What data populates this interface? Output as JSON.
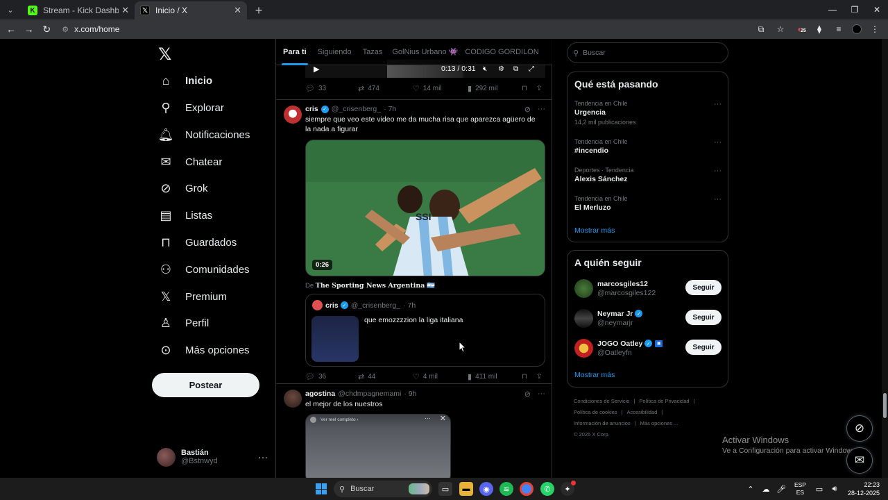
{
  "browser": {
    "tabs": [
      {
        "title": "Stream - Kick Dashboard",
        "favicon": "kick-icon",
        "active": false
      },
      {
        "title": "Inicio / X",
        "favicon": "x-icon",
        "active": true
      }
    ],
    "url": "x.com/home",
    "extension_badge": "25"
  },
  "sidebar": {
    "items": [
      {
        "label": "Inicio",
        "icon": "home-icon"
      },
      {
        "label": "Explorar",
        "icon": "search-icon"
      },
      {
        "label": "Notificaciones",
        "icon": "bell-icon"
      },
      {
        "label": "Chatear",
        "icon": "mail-icon"
      },
      {
        "label": "Grok",
        "icon": "grok-icon"
      },
      {
        "label": "Listas",
        "icon": "list-icon"
      },
      {
        "label": "Guardados",
        "icon": "bookmark-icon"
      },
      {
        "label": "Comunidades",
        "icon": "people-icon"
      },
      {
        "label": "Premium",
        "icon": "x-logo-icon"
      },
      {
        "label": "Perfil",
        "icon": "person-icon"
      },
      {
        "label": "Más opciones",
        "icon": "more-circle-icon"
      }
    ],
    "post_button": "Postear",
    "account": {
      "name": "Bastián",
      "handle": "@Bstnwyd"
    }
  },
  "feed": {
    "tabs": [
      "Para ti",
      "Siguiendo",
      "Tazas",
      "GolNius Urbano 👾",
      "CODIGO GORDILON"
    ],
    "prev_post": {
      "video_time": "0:13 / 0:31",
      "replies": "33",
      "reposts": "474",
      "likes": "14 mil",
      "views": "292 mil"
    },
    "post1": {
      "name": "cris",
      "handle": "@_crisenberg_",
      "time": "· 7h",
      "text": "siempre que veo este video me da mucha risa que aparezca agüero de la nada a figurar",
      "duration": "0:26",
      "source_prefix": "De",
      "source_name": "The Sporting News Argentina",
      "source_flag": "🇦🇷",
      "quote": {
        "name": "cris",
        "handle": "@_crisenberg_",
        "time": "· 7h",
        "text": "que emozzzzion la liga italiana"
      },
      "replies": "36",
      "reposts": "44",
      "likes": "4 mil",
      "views": "411 mil"
    },
    "post2": {
      "name": "agostina",
      "handle": "@chdmpagnemami",
      "time": "· 9h",
      "text": "el mejor de los nuestros",
      "embed_label": "Ver reel completo ›"
    }
  },
  "right": {
    "search_placeholder": "Buscar",
    "trends_title": "Qué está pasando",
    "trends": [
      {
        "category": "Tendencia en Chile",
        "name": "Urgencia",
        "count": "14,2 mil publicaciones"
      },
      {
        "category": "Tendencia en Chile",
        "name": "#incendio",
        "count": ""
      },
      {
        "category": "Deportes · Tendencia",
        "name": "Alexis Sánchez",
        "count": ""
      },
      {
        "category": "Tendencia en Chile",
        "name": "El Merluzo",
        "count": ""
      }
    ],
    "show_more": "Mostrar más",
    "follow_title": "A quién seguir",
    "follow": [
      {
        "name": "marcosgiles12",
        "handle": "@marcosgiles122",
        "button": "Seguir"
      },
      {
        "name": "Neymar Jr",
        "handle": "@neymarjr",
        "button": "Seguir"
      },
      {
        "name": "JOGO Oatley",
        "handle": "@Oatleyfn",
        "button": "Seguir"
      }
    ],
    "footer": [
      "Condiciones de Servicio",
      "|",
      "Política de Privacidad",
      "|",
      "Política de cookies",
      "|",
      "Accesibilidad",
      "|",
      "Información de anuncios",
      "|",
      "Más opciones ...",
      "© 2025 X Corp."
    ]
  },
  "watermark": {
    "line1": "Activar Windows",
    "line2": "Ve a Configuración para activar Windows."
  },
  "taskbar": {
    "search_placeholder": "Buscar",
    "lang_top": "ESP",
    "lang_bottom": "ES",
    "time": "22:23",
    "date": "28-12-2025"
  },
  "colors": {
    "accent": "#1d9bf0",
    "background": "#000000",
    "text": "#e7e9ea",
    "muted": "#71767b"
  }
}
